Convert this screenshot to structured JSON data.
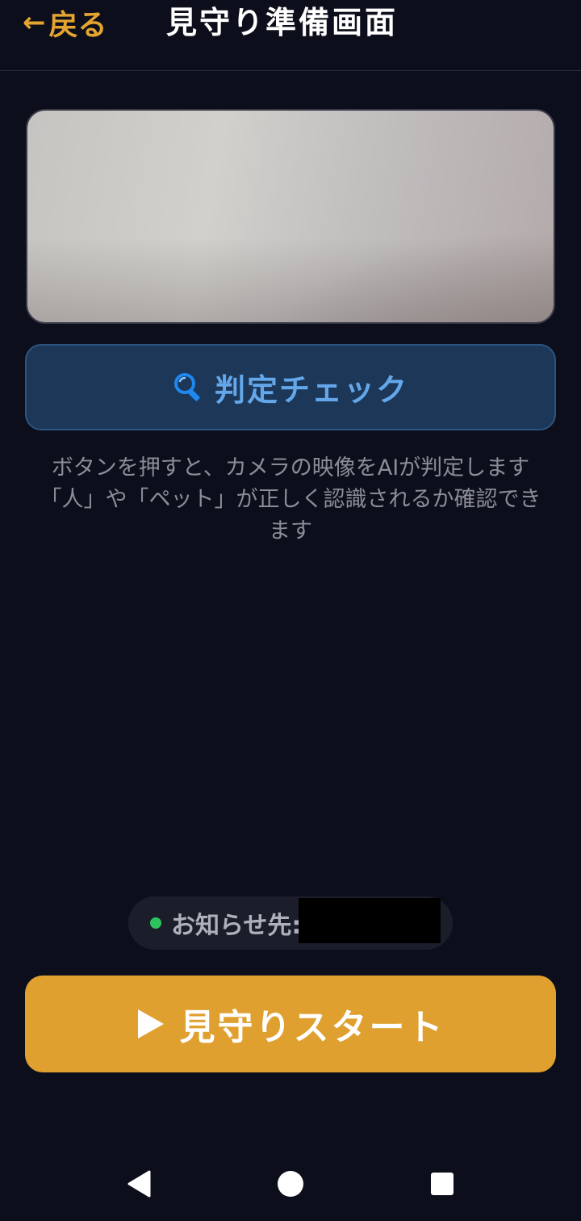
{
  "header": {
    "back_arrow": "←",
    "back_label": "戻る",
    "title": "見守り準備画面"
  },
  "check_button": {
    "icon": "magnifier-icon",
    "label": "判定チェック"
  },
  "description": {
    "line1": "ボタンを押すと、カメラの映像をAIが判定します",
    "line2": "「人」や「ペット」が正しく認識されるか確認できます"
  },
  "notification": {
    "label": "お知らせ先:",
    "value": "",
    "status_color": "#2ec25f"
  },
  "start_button": {
    "icon": "play-icon",
    "label": "見守りスタート"
  },
  "colors": {
    "background": "#0d0e1b",
    "accent": "#e0a030",
    "check_button_bg": "#1c3757",
    "check_button_text": "#63a7ea"
  },
  "nav_bar": {
    "back": "nav-back-icon",
    "home": "nav-home-icon",
    "recent": "nav-recent-icon"
  }
}
